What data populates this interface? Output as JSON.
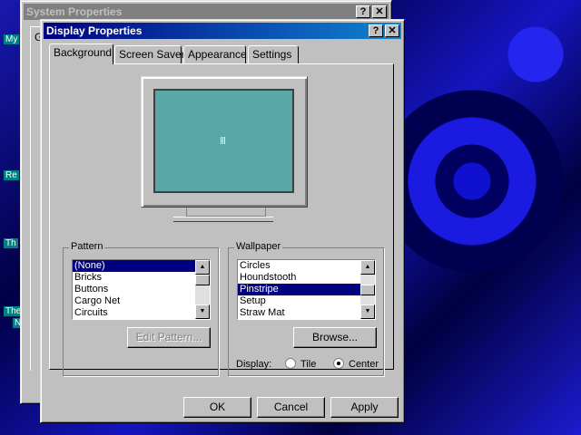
{
  "desktop": {
    "icon_labels": [
      "My",
      "Re",
      "Th",
      "The",
      "N"
    ]
  },
  "back_window": {
    "title": "System Properties",
    "help_label": "?",
    "close_label": "✕",
    "tab_fragment": "G"
  },
  "dialog": {
    "title": "Display Properties",
    "help_label": "?",
    "close_label": "✕",
    "tabs": [
      {
        "label": "Background",
        "selected": true
      },
      {
        "label": "Screen Saver",
        "selected": false
      },
      {
        "label": "Appearance",
        "selected": false
      },
      {
        "label": "Settings",
        "selected": false
      }
    ],
    "pattern": {
      "legend": "Pattern",
      "items": [
        "(None)",
        "Bricks",
        "Buttons",
        "Cargo Net",
        "Circuits"
      ],
      "selected": "(None)",
      "edit_button": "Edit Pattern..."
    },
    "wallpaper": {
      "legend": "Wallpaper",
      "items": [
        "Circles",
        "Houndstooth",
        "Pinstripe",
        "Setup",
        "Straw Mat"
      ],
      "selected": "Pinstripe",
      "browse_button": "Browse...",
      "display_label": "Display:",
      "display_options": [
        "Tile",
        "Center"
      ],
      "display_selected": "Center"
    },
    "buttons": {
      "ok": "OK",
      "cancel": "Cancel",
      "apply": "Apply"
    }
  },
  "colors": {
    "active_title": "#000080",
    "preview_screen": "#5aa7a7",
    "selection": "#000080"
  }
}
